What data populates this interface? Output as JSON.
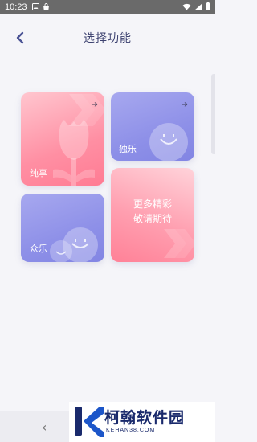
{
  "status_bar": {
    "time": "10:23",
    "left_icons": [
      "image-icon",
      "bag-icon"
    ],
    "right_icons": [
      "wifi-icon",
      "signal-icon",
      "battery-icon"
    ]
  },
  "header": {
    "title": "选择功能"
  },
  "cards": {
    "chunxiang": {
      "label": "纯享"
    },
    "dule": {
      "label": "独乐"
    },
    "zhongle": {
      "label": "众乐"
    },
    "more": {
      "line1": "更多精彩",
      "line2": "敬请期待"
    }
  },
  "watermark": {
    "brand": "柯翰软件园",
    "domain": "KEHAN38.COM"
  },
  "colors": {
    "title": "#3d4270",
    "pink": "#ff8fa3",
    "blue": "#8e90e8"
  }
}
